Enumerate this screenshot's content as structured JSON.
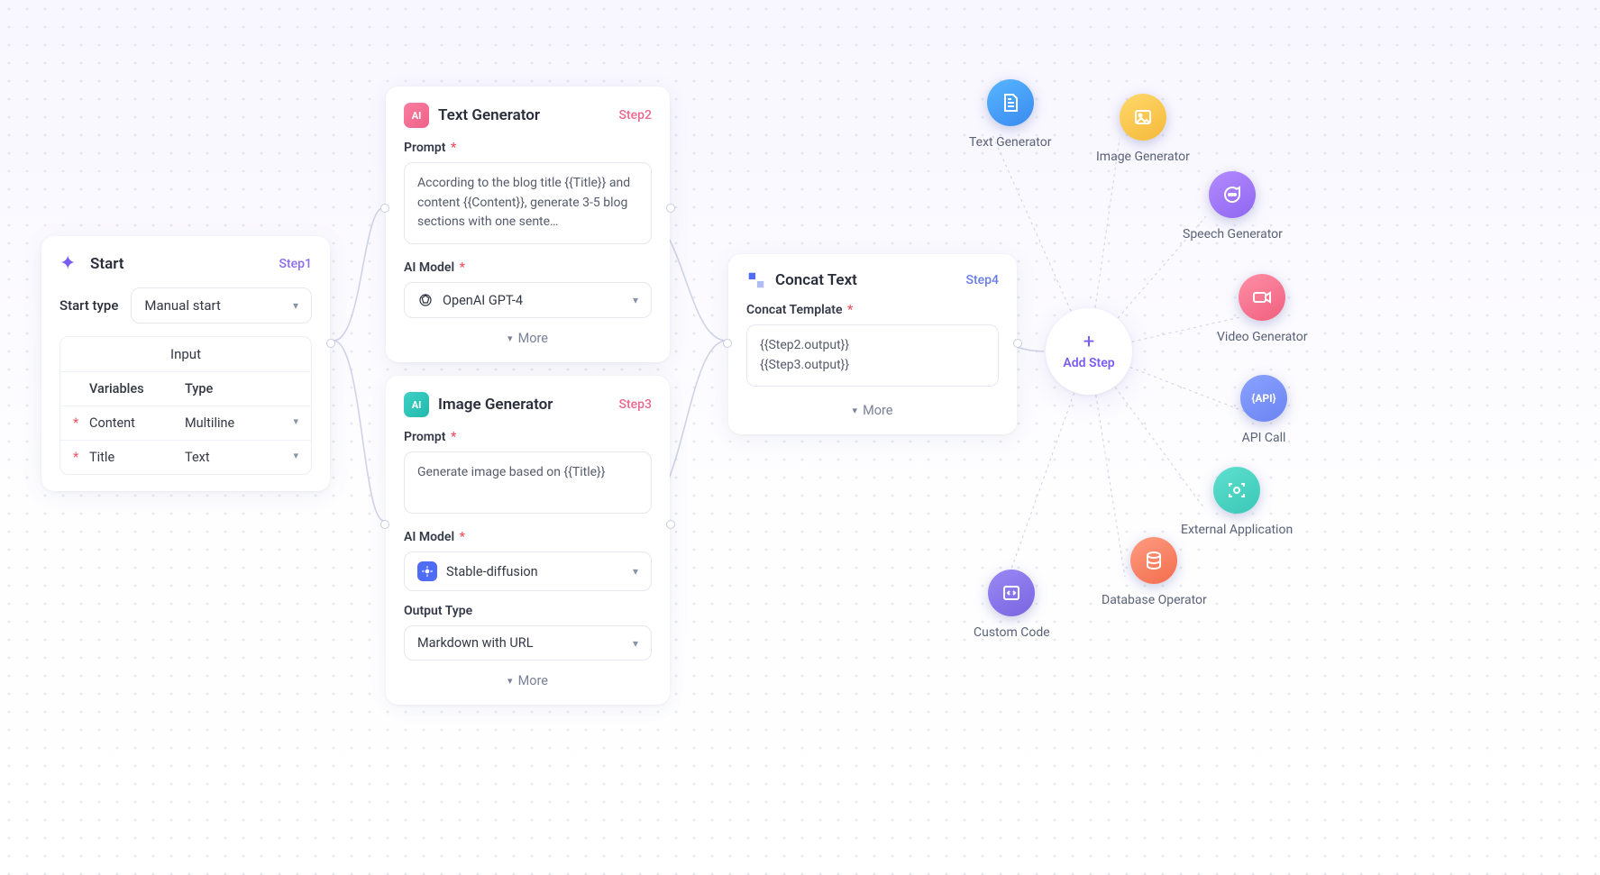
{
  "start": {
    "title": "Start",
    "step": "Step1",
    "type_label": "Start type",
    "type_value": "Manual start",
    "inputs_title": "Input",
    "col_var": "Variables",
    "col_type": "Type",
    "rows": [
      {
        "name": "Content",
        "type": "Multiline"
      },
      {
        "name": "Title",
        "type": "Text"
      }
    ]
  },
  "text_gen": {
    "badge": "AI",
    "title": "Text Generator",
    "step": "Step2",
    "prompt_label": "Prompt",
    "prompt_value": "According to the blog title {{Title}} and content {{Content}}, generate 3-5 blog sections with one sente…",
    "model_label": "AI Model",
    "model_value": "OpenAI GPT-4",
    "more": "More"
  },
  "image_gen": {
    "badge": "AI",
    "title": "Image Generator",
    "step": "Step3",
    "prompt_label": "Prompt",
    "prompt_value": "Generate image based on {{Title}}",
    "model_label": "AI Model",
    "model_value": "Stable-diffusion",
    "output_label": "Output Type",
    "output_value": "Markdown with URL",
    "more": "More"
  },
  "concat": {
    "title": "Concat Text",
    "step": "Step4",
    "tmpl_label": "Concat Template",
    "tmpl_value": "{{Step2.output}}\n{{Step3.output}}",
    "more": "More"
  },
  "hub": {
    "label": "Add Step"
  },
  "palette": {
    "text": "Text Generator",
    "image": "Image Generator",
    "speech": "Speech Generator",
    "video": "Video Generator",
    "api": "API Call",
    "ext": "External Application",
    "db": "Database Operator",
    "code": "Custom Code"
  }
}
